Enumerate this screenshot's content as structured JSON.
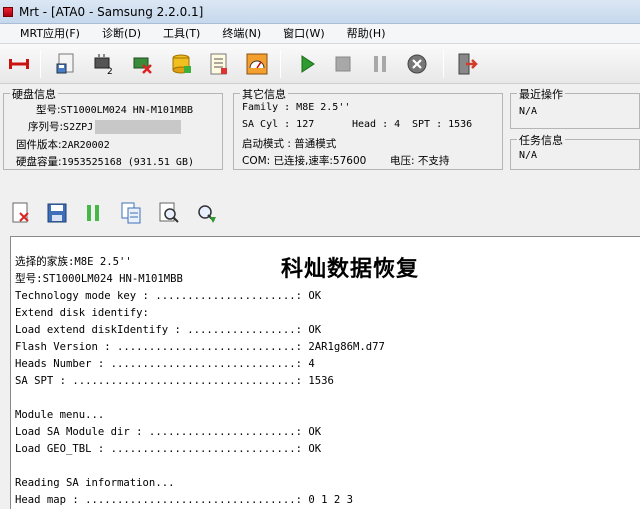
{
  "window": {
    "title": "Mrt - [ATA0 - Samsung 2.2.0.1]"
  },
  "menu": [
    {
      "label": "MRT应用(F)"
    },
    {
      "label": "诊断(D)"
    },
    {
      "label": "工具(T)"
    },
    {
      "label": "终端(N)"
    },
    {
      "label": "窗口(W)"
    },
    {
      "label": "帮助(H)"
    }
  ],
  "toolbar_icons": [
    "connect-icon",
    "save-disk-icon",
    "chip-tool-icon",
    "chip-delete-icon",
    "database-icon",
    "report-icon",
    "gauge-icon",
    "play-icon",
    "stop-icon",
    "pause-icon",
    "cancel-icon",
    "exit-icon"
  ],
  "disk_info": {
    "title": "硬盘信息",
    "model_label": "型号:",
    "model_value": "ST1000LM024 HN-M101MBB",
    "serial_label": "序列号:",
    "serial_value": "S2ZPJ",
    "firmware_label": "固件版本:",
    "firmware_value": "2AR20002",
    "capacity_label": "硬盘容量:",
    "capacity_value": "1953525168 (931.51 GB)"
  },
  "other_info": {
    "title": "其它信息",
    "family": "Family : M8E 2.5''",
    "sa_cyl": "SA Cyl : 127",
    "head": "Head : 4",
    "spt": "SPT : 1536",
    "boot_mode": "启动模式 : 普通模式",
    "com": "COM: 已连接,速率:57600",
    "voltage": "电压: 不支持"
  },
  "recent_ops": {
    "title": "最近操作",
    "value": "N/A"
  },
  "task_info": {
    "title": "任务信息",
    "value": "N/A"
  },
  "toolbar2_icons": [
    "close-doc-icon",
    "save-icon",
    "pause-green-icon",
    "copy-icon",
    "search-doc-icon",
    "download-icon"
  ],
  "watermark": "科灿数据恢复",
  "log_lines": [
    "选择的家族:M8E 2.5''",
    "型号:ST1000LM024 HN-M101MBB",
    "Technology mode key : ......................: OK",
    "Extend disk identify:",
    "Load extend diskIdentify : .................: OK",
    "Flash Version : ............................: 2AR1g86M.d77",
    "Heads Number : .............................: 4",
    "SA SPT : ...................................: 1536",
    "",
    "Module menu...",
    "Load SA Module dir : .......................: OK",
    "Load GEO_TBL : .............................: OK",
    "",
    "Reading SA information...",
    "Head map : .................................: 0 1 2 3"
  ],
  "colors": {
    "play": "#2e9b2e",
    "exit": "#d23a2a",
    "connect": "#cc1111"
  }
}
